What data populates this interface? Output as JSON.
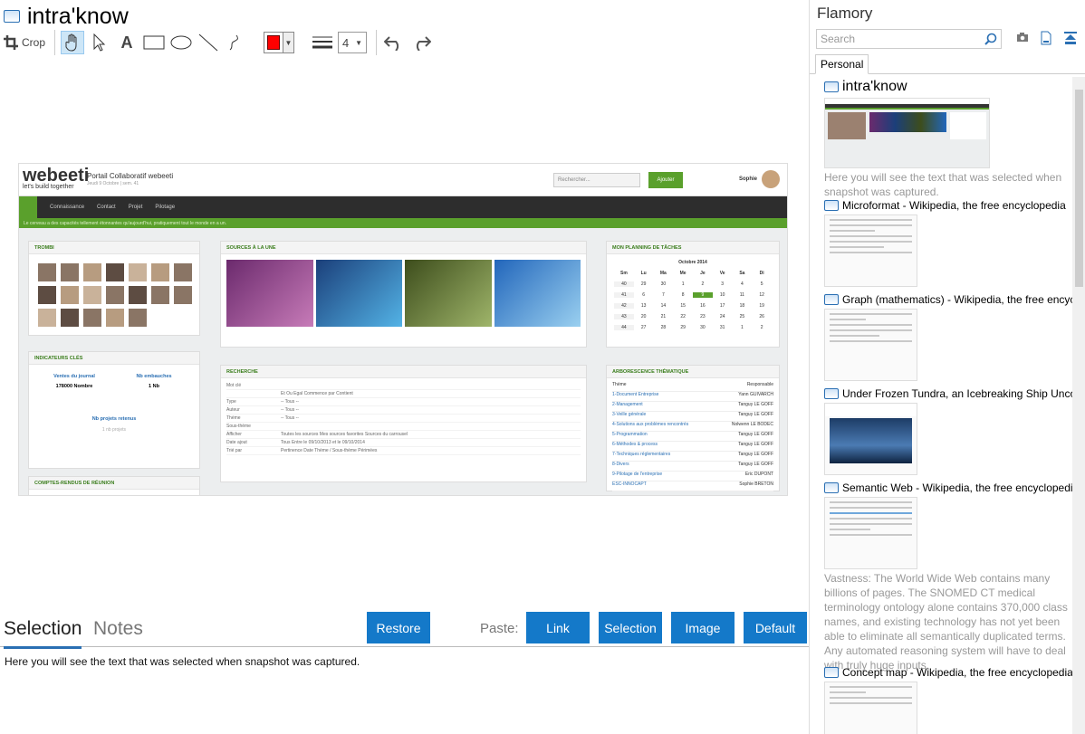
{
  "app": {
    "title": "intra'know"
  },
  "toolbar": {
    "crop_label": "Crop",
    "color": "#ff0000",
    "line_width": "4",
    "icons": [
      "crop-icon",
      "hand-icon",
      "pointer-icon",
      "text-icon",
      "rectangle-icon",
      "ellipse-icon",
      "line-icon",
      "freehand-icon",
      "line-width-icon",
      "undo-icon",
      "redo-icon"
    ]
  },
  "snapshot": {
    "logo": "webeeti",
    "logo_sub": "let's build together",
    "portal_title": "Portail Collaboratif webeeti",
    "portal_sub": "Jeudi 9 Octobre | sem. 41",
    "search_placeholder": "Rechercher...",
    "add_button": "Ajouter",
    "user": "Sophie",
    "nav": [
      "Connaissance",
      "Contact",
      "Projet",
      "Pilotage"
    ],
    "banner": "Le cerveau a des capacités tellement étonnantes qu'aujourd'hui, pratiquement tout le monde en a un.",
    "trombi": {
      "title": "TROMBI",
      "search": "Recherche"
    },
    "sources": {
      "title": "SOURCES À LA UNE",
      "items": [
        "La croissance pour 2014",
        "Intégrer les nouvelles t...",
        "ISO 50001 - Managem...",
        "Dépenses IT"
      ]
    },
    "planning": {
      "title": "MON PLANNING DE TÂCHES",
      "month": "Octobre 2014",
      "days": [
        "Sm",
        "Lu",
        "Ma",
        "Me",
        "Je",
        "Ve",
        "Sa",
        "Di"
      ],
      "weeks": [
        [
          "40",
          "29",
          "30",
          "1",
          "2",
          "3",
          "4",
          "5"
        ],
        [
          "41",
          "6",
          "7",
          "8",
          "9",
          "10",
          "11",
          "12"
        ],
        [
          "42",
          "13",
          "14",
          "15",
          "16",
          "17",
          "18",
          "19"
        ],
        [
          "43",
          "20",
          "21",
          "22",
          "23",
          "24",
          "25",
          "26"
        ],
        [
          "44",
          "27",
          "28",
          "29",
          "30",
          "31",
          "1",
          "2"
        ]
      ]
    },
    "indicators": {
      "title": "INDICATEURS CLÉS",
      "col1": "Ventes du journal",
      "col1_val": "178000 Nombre",
      "col2": "Nb embauches",
      "col2_val": "1 Nb",
      "col2_sub": "/ 1 Nb",
      "col3": "Nb projets retenus",
      "col3_sub": "1 nb projets"
    },
    "recherche": {
      "title": "RECHERCHE",
      "propose": "Proposer thème",
      "submit": "Rechercher",
      "labels": [
        "Mot clé",
        "",
        "Type",
        "Auteur",
        "Thème",
        "Sous-thème",
        "Afficher",
        "Date ajout",
        "Trié par"
      ],
      "values": [
        "",
        "Et   Ou   Egal   Commence par   Contient",
        "-- Tous --",
        "-- Tous --",
        "-- Tous --",
        "",
        "Toutes les sources   Mes sources favorites   Sources du carrousel",
        "Tous   Entre le 09/10/2013 et le 09/10/2014",
        "Pertinence   Date   Thème / Sous-thème   Périmées"
      ]
    },
    "arbo": {
      "title": "ARBORESCENCE THÉMATIQUE",
      "col_theme": "Thème",
      "col_resp": "Responsable",
      "rows": [
        [
          "1-Document Entreprise",
          "Yann GUIVARCH"
        ],
        [
          "2-Management",
          "Tanguy LE GOFF"
        ],
        [
          "3-Veille générale",
          "Tanguy LE GOFF"
        ],
        [
          "4-Solutions aux problèmes rencontrés",
          "Nolwenn LE BODEC"
        ],
        [
          "5-Programmation",
          "Tanguy LE GOFF"
        ],
        [
          "6-Méthodes & process",
          "Tanguy LE GOFF"
        ],
        [
          "7-Techniques réglementaires",
          "Tanguy LE GOFF"
        ],
        [
          "8-Divers",
          "Tanguy LE GOFF"
        ],
        [
          "9-Pilotage de l'entreprise",
          "Eric DUPONT"
        ],
        [
          "ESC-INNOCAPT",
          "Sophie BRETON"
        ]
      ]
    },
    "comptes": {
      "title": "COMPTES-RENDUS DE RÉUNION"
    }
  },
  "bottom": {
    "tab_selection": "Selection",
    "tab_notes": "Notes",
    "restore": "Restore",
    "paste_label": "Paste:",
    "paste_link": "Link",
    "paste_selection": "Selection",
    "paste_image": "Image",
    "paste_default": "Default",
    "selection_text": "Here you will see the text that was selected when snapshot was captured."
  },
  "flamory": {
    "title": "Flamory",
    "search_placeholder": "Search",
    "tab": "Personal",
    "items": [
      {
        "title": "intra'know",
        "desc": "Here you will see the text that was selected when snapshot was captured."
      },
      {
        "title": "Microformat - Wikipedia, the free encyclopedia",
        "desc": ""
      },
      {
        "title": "Graph (mathematics) - Wikipedia, the free encyclopedia",
        "desc": ""
      },
      {
        "title": "Under Frozen Tundra, an Icebreaking Ship Uncovers",
        "desc": ""
      },
      {
        "title": "Semantic Web - Wikipedia, the free encyclopedia",
        "desc": "Vastness: The World Wide Web contains many billions of pages. The SNOMED CT medical terminology ontology alone contains 370,000 class names, and existing technology has not yet been able to eliminate all semantically duplicated terms. Any automated reasoning system will have to deal with truly huge inputs."
      },
      {
        "title": "Concept map - Wikipedia, the free encyclopedia",
        "desc": ""
      }
    ]
  }
}
